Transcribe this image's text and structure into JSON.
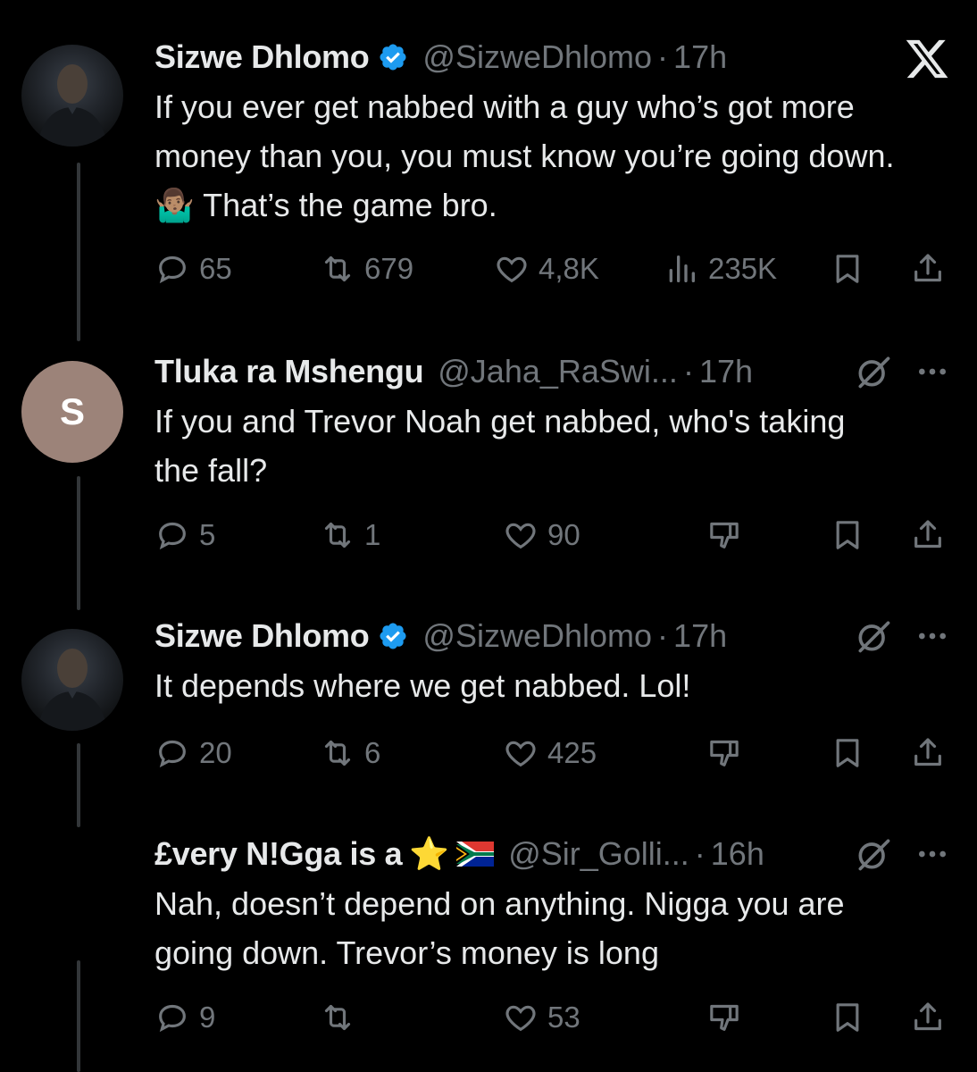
{
  "tweets": [
    {
      "name": "Sizwe Dhlomo",
      "handle": "@SizweDhlomo",
      "dot": "·",
      "time": "17h",
      "text_parts": [
        "If you ever get nabbed with a guy who’s got more money than you, you must know you’re going down. ",
        "🤷🏽‍♂️",
        " That’s the game bro."
      ],
      "replies": "65",
      "reposts": "679",
      "likes": "4,8K",
      "views": "235K"
    },
    {
      "avatar_letter": "S",
      "name": "Tluka ra Mshengu",
      "handle": "@Jaha_RaSwi...",
      "dot": "·",
      "time": "17h",
      "text": "If you and Trevor Noah get nabbed,  who's taking the fall?",
      "replies": "5",
      "reposts": "1",
      "likes": "90"
    },
    {
      "name": "Sizwe Dhlomo",
      "handle": "@SizweDhlomo",
      "dot": "·",
      "time": "17h",
      "text": "It depends where we get nabbed. Lol!",
      "replies": "20",
      "reposts": "6",
      "likes": "425"
    },
    {
      "name": "£very N!Gga is a",
      "name_emoji": "⭐",
      "handle": "@Sir_Golli...",
      "dot": "·",
      "time": "16h",
      "text": "Nah, doesn’t depend on anything. Nigga you are going down. Trevor’s money is long",
      "replies": "9",
      "reposts": "",
      "likes": "53"
    }
  ],
  "colors": {
    "background": "#000000",
    "text": "#e7e9ea",
    "secondary": "#71767b",
    "verified": "#1d9bf0",
    "avatar_letter_bg": "#9c8379"
  },
  "icons": [
    "x-logo-icon",
    "verified-badge-icon",
    "grok-icon",
    "more-icon",
    "reply-icon",
    "repost-icon",
    "like-icon",
    "views-icon",
    "downvote-icon",
    "bookmark-icon",
    "share-icon",
    "south-africa-flag-icon"
  ]
}
